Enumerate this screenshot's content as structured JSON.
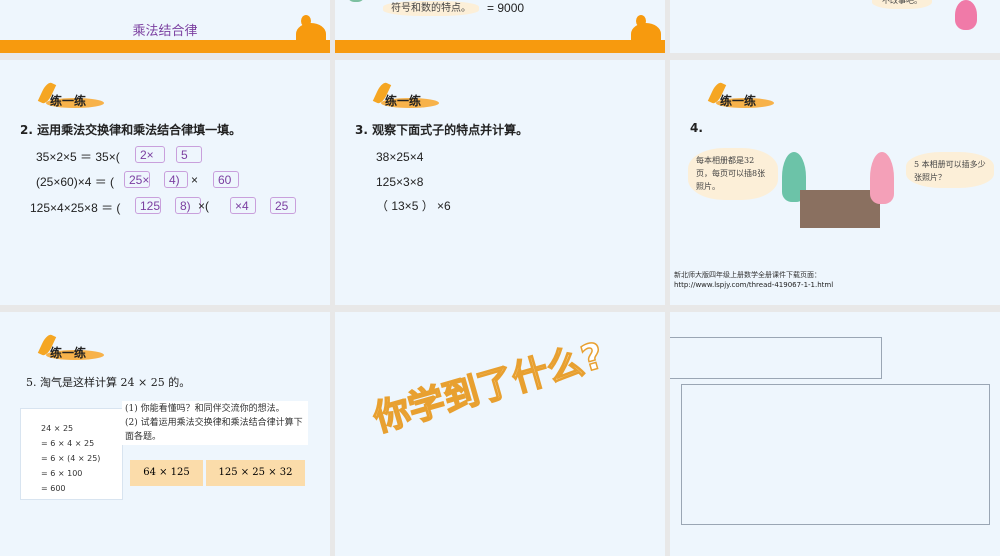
{
  "slides": {
    "s1": {
      "title": "乘法结合律"
    },
    "s2": {
      "bubble": "符号和数的特点。",
      "result": "= 9000"
    },
    "s3": {
      "bubble": "不改事吧。"
    },
    "s4": {
      "badge": "练一练",
      "question": "2. 运用乘法交换律和乘法结合律填一填。",
      "rows": [
        {
          "left": "35×2×5 ＝ 35×(",
          "boxes": [
            "2×",
            "5"
          ]
        },
        {
          "left": "(25×60)×4 ＝ (",
          "boxes": [
            "25×",
            "4)",
            "60"
          ],
          "sep": "×"
        },
        {
          "left": "125×4×25×8 ＝ (",
          "boxes": [
            "125",
            "8)",
            "×4",
            "25"
          ],
          "sep": "×("
        }
      ]
    },
    "s5": {
      "badge": "练一练",
      "question": "3. 观察下面式子的特点并计算。",
      "exprs": [
        "38×25×4",
        "125×3×8",
        "（ 13×5 ） ×6"
      ]
    },
    "s6": {
      "badge": "练一练",
      "question": "4.",
      "bubble_left": "每本相册都是32页，每页可以插8张照片。",
      "bubble_right": "5 本相册可以插多少张照片？",
      "footer_line1": "新北师大版四年级上册数学全册课件下载页面：",
      "footer_line2": "http://www.lspjy.com/thread-419067-1-1.html"
    },
    "s7": {
      "badge": "练一练",
      "question": "5. 淘气是这样计算 24 × 25 的。",
      "note": [
        "24 × 25",
        "= 6 × 4 × 25",
        "= 6 × (4 × 25)",
        "= 6 × 100",
        "= 600"
      ],
      "sub1": "(1) 你能看懂吗？和同伴交流你的想法。",
      "sub2": "(2) 试着运用乘法交换律和乘法结合律计算下面各题。",
      "task1": "64 × 125",
      "task2": "125 × 25 × 32"
    },
    "s8": {
      "art_text": "你学到了什么?"
    }
  },
  "colors": {
    "accent": "#f79a0e",
    "slide_bg": "#eef6fd",
    "title": "#7b3fa0"
  }
}
